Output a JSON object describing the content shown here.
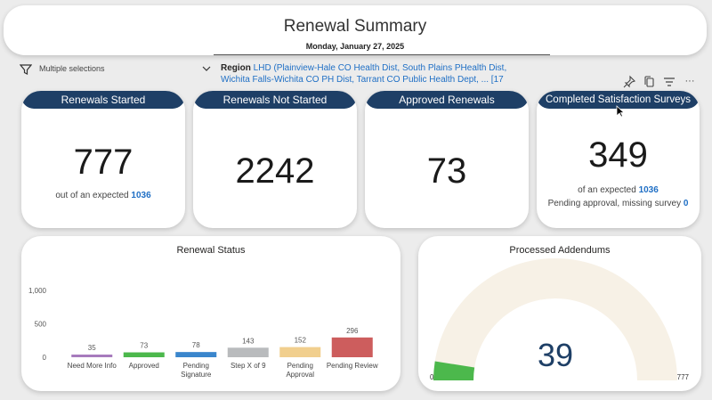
{
  "header": {
    "title": "Renewal Summary",
    "date": "Monday, January 27, 2025"
  },
  "filter": {
    "text": "Multiple selections",
    "icon": "funnel-icon"
  },
  "region": {
    "label": "Region",
    "value": "LHD (Plainview-Hale CO Health Dist, South Plains PHealth Dist, Wichita Falls-Wichita CO PH Dist, Tarrant CO Public Health Dept, ... [17"
  },
  "toolbar": {
    "icons": [
      "pin-icon",
      "copy-icon",
      "filter-icon",
      "more-options-icon"
    ],
    "more_label": "···"
  },
  "kpis": {
    "started": {
      "title": "Renewals Started",
      "value": "777",
      "sub_prefix": "out of an expected",
      "sub_value": "1036"
    },
    "not_started": {
      "title": "Renewals Not Started",
      "value": "2242"
    },
    "approved": {
      "title": "Approved Renewals",
      "value": "73"
    },
    "surveys": {
      "title": "Completed Satisfaction Surveys",
      "value": "349",
      "sub_prefix": "of an expected",
      "sub_value": "1036",
      "pending_prefix": "Pending approval, missing survey",
      "pending_value": "0"
    }
  },
  "colors": {
    "header_blue": "#1e3f66",
    "link_blue": "#1f6fc5",
    "gauge_fill": "#4cb84c",
    "gauge_track": "#f7f1e6",
    "gauge_value": "#1e3f66"
  },
  "chart_data": [
    {
      "type": "bar",
      "title": "Renewal Status",
      "categories": [
        "Need More Info",
        "Approved",
        "Pending Signature",
        "Step X of 9",
        "Pending Approval",
        "Pending Review"
      ],
      "category_lines": [
        [
          "Need More Info"
        ],
        [
          "Approved"
        ],
        [
          "Pending",
          "Signature"
        ],
        [
          "Step X of 9"
        ],
        [
          "Pending",
          "Approval"
        ],
        [
          "Pending Review"
        ]
      ],
      "values": [
        35,
        73,
        78,
        143,
        152,
        296
      ],
      "colors": [
        "#a77bbd",
        "#4cb84c",
        "#3a86cc",
        "#b9bbbd",
        "#f1cf8e",
        "#cd5d5d"
      ],
      "yticks": [
        0,
        500,
        1000
      ],
      "ytick_labels": [
        "0",
        "500",
        "1,000"
      ],
      "ylim": [
        0,
        1000
      ],
      "grid": false,
      "data_labels": true
    },
    {
      "type": "gauge",
      "title": "Processed Addendums",
      "value": 39,
      "value_label": "39",
      "min": 0,
      "max": 777,
      "min_label": "0",
      "max_label": "777"
    }
  ]
}
